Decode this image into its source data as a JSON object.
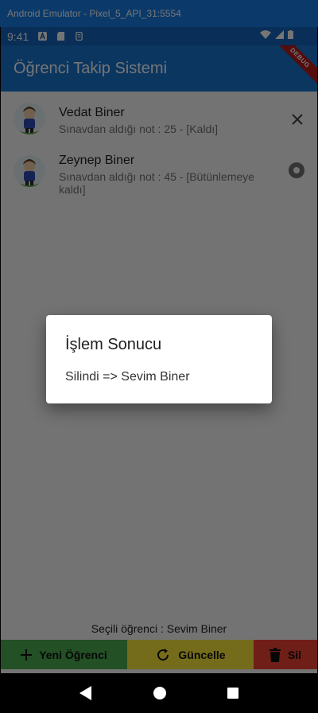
{
  "emulator": {
    "title": "Android Emulator - Pixel_5_API_31:5554"
  },
  "status_bar": {
    "time": "9:41"
  },
  "app_bar": {
    "title": "Öğrenci Takip Sistemi",
    "debug_banner": "DEBUG"
  },
  "students": [
    {
      "name": "Vedat Biner",
      "subtitle": "Sınavdan aldığı not : 25 - [Kaldı]",
      "trailing_icon": "close-icon"
    },
    {
      "name": "Zeynep Biner",
      "subtitle": "Sınavdan aldığı not : 45 - [Bütünlemeye kaldı]",
      "trailing_icon": "record-icon"
    }
  ],
  "selected_label": "Seçili öğrenci : Sevim Biner",
  "buttons": {
    "new_student": "Yeni Öğrenci",
    "update": "Güncelle",
    "delete": "Sil"
  },
  "dialog": {
    "title": "İşlem Sonucu",
    "message": "Silindi => Sevim Biner"
  },
  "colors": {
    "app_bar": "#1976d2",
    "status_bar": "#1565c0",
    "green": "#4caf50",
    "yellow": "#ffeb3b",
    "red": "#f44336"
  }
}
